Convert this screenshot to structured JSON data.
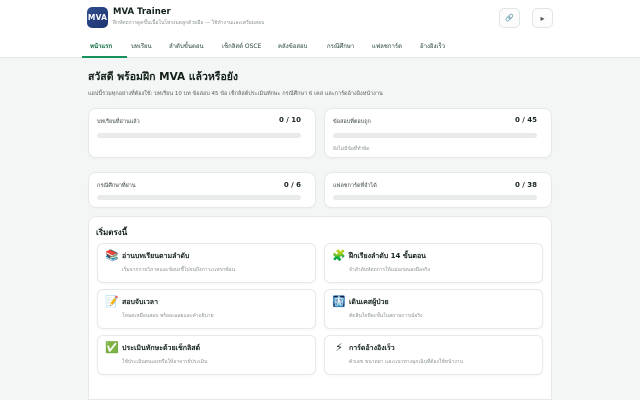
{
  "header": {
    "logo_text": "MVA",
    "title": "MVA Trainer",
    "subtitle": "ฝึกหัตถการดูดขึ้นเนื้อในโพรงมดลูกด้วยมือ — ใช้ทำงานและเตรียมสอบ",
    "link_icon": "🔗",
    "menu_icon": "▸"
  },
  "tabs": [
    {
      "label": "หน้าแรก",
      "active": true
    },
    {
      "label": "บทเรียน"
    },
    {
      "label": "ลำดับขั้นตอน"
    },
    {
      "label": "เช็กลิสต์ OSCE"
    },
    {
      "label": "คลังข้อสอบ"
    },
    {
      "label": "กรณีศึกษา"
    },
    {
      "label": "แฟลชการ์ด"
    },
    {
      "label": "อ้างอิงเร็ว"
    }
  ],
  "page": {
    "title": "สวัสดี พร้อมฝึก MVA แล้วหรือยัง",
    "subtitle": "แอปนี้รวมทุกอย่างที่ต้องใช้: บทเรียน 10 บท ข้อสอบ 45 ข้อ เช็กลิสต์ประเมินทักษะ กรณีศึกษา 6 เคส และการ์ดอ้างอิงหน้างาน"
  },
  "stats": [
    {
      "label": "บทเรียนที่อ่านแล้ว",
      "value": "0 / 10",
      "progress": 0,
      "note": ""
    },
    {
      "label": "ข้อสอบที่ตอบถูก",
      "value": "0 / 45",
      "progress": 0,
      "note": "ยังไม่มีข้อที่ทำผิด"
    },
    {
      "label": "กรณีศึกษาที่ผ่าน",
      "value": "0 / 6",
      "progress": 0,
      "note": ""
    },
    {
      "label": "แฟลชการ์ดที่จำได้",
      "value": "0 / 38",
      "progress": 0,
      "note": ""
    }
  ],
  "quick_start": {
    "title": "เริ่มตรงนี้",
    "actions": [
      {
        "icon": "📚",
        "icon_name": "books-icon",
        "title": "อ่านบทเรียนตามลำดับ",
        "desc": "เริ่มจากกายวิภาคและข้อบ่งชี้ไปจนถึงภาวะแทรกซ้อน"
      },
      {
        "icon": "🧩",
        "icon_name": "puzzle-icon",
        "title": "ฝึกเรียงลำดับ 14 ขั้นตอน",
        "desc": "จำลำดับหัตถการให้แม่นก่อนลงมือจริง"
      },
      {
        "icon": "📝",
        "icon_name": "memo-icon",
        "title": "สอบจับเวลา",
        "desc": "โหมดเหมือนสอบ พร้อมเฉลยและคำอธิบาย"
      },
      {
        "icon": "🩻",
        "icon_name": "xray-icon",
        "title": "เดินเคสผู้ป่วย",
        "desc": "ตัดสินใจทีละขั้นในสถานการณ์จริง"
      },
      {
        "icon": "✅",
        "icon_name": "checkmark-icon",
        "title": "ประเมินทักษะด้วยเช็กลิสต์",
        "desc": "ใช้ประเมินตนเองหรือให้อาจารย์ประเมิน"
      },
      {
        "icon": "⚡",
        "icon_name": "lightning-icon",
        "title": "การ์ดอ้างอิงเร็ว",
        "desc": "ตัวเลข ขนาดยา และแนวทางฉุกเฉินที่ต้องใช้หน้างาน"
      }
    ]
  },
  "colors": {
    "accent": "#16925a",
    "logo": "#2f4d8f",
    "background": "#f4f6f5"
  }
}
